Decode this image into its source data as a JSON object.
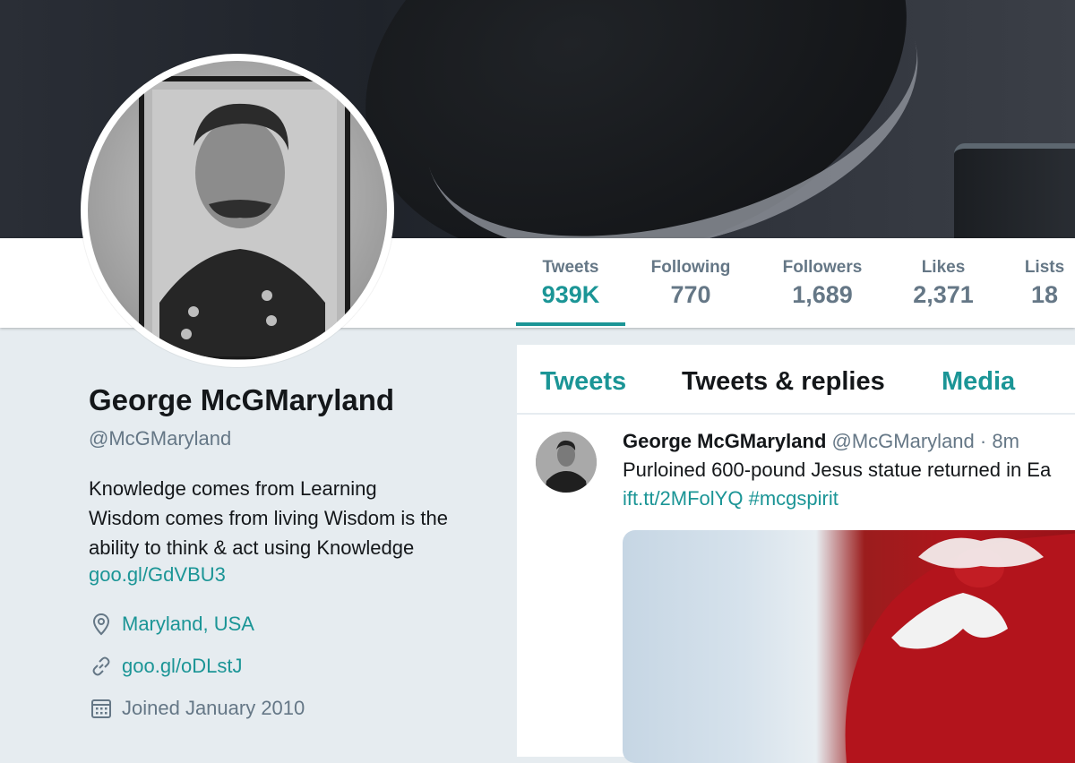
{
  "colors": {
    "accent": "#1b9596",
    "secondary_text": "#657786",
    "primary_text": "#14171a",
    "background": "#e6ecf0"
  },
  "stats": [
    {
      "label": "Tweets",
      "value": "939K",
      "active": true
    },
    {
      "label": "Following",
      "value": "770"
    },
    {
      "label": "Followers",
      "value": "1,689"
    },
    {
      "label": "Likes",
      "value": "2,371"
    },
    {
      "label": "Lists",
      "value": "18"
    }
  ],
  "profile": {
    "name": "George McGMaryland",
    "handle": "@McGMaryland",
    "bio_lines": [
      "Knowledge comes from Learning",
      "Wisdom comes from living Wisdom is the",
      "ability to think & act using Knowledge"
    ],
    "bio_link": "goo.gl/GdVBU3",
    "location": "Maryland, USA",
    "website": "goo.gl/oDLstJ",
    "joined": "Joined January 2010",
    "location_icon": "location-pin-icon",
    "website_icon": "link-icon",
    "joined_icon": "calendar-icon"
  },
  "timeline": {
    "tabs": [
      {
        "label": "Tweets"
      },
      {
        "label": "Tweets & replies"
      },
      {
        "label": "Media"
      }
    ],
    "tweet": {
      "author": "George McGMaryland",
      "handle": "@McGMaryland",
      "separator": "·",
      "time": "8m",
      "text": "Purloined 600-pound Jesus statue returned in Ea",
      "link1": "ift.tt/2MFolYQ",
      "hashtag": "#mcgspirit"
    }
  }
}
